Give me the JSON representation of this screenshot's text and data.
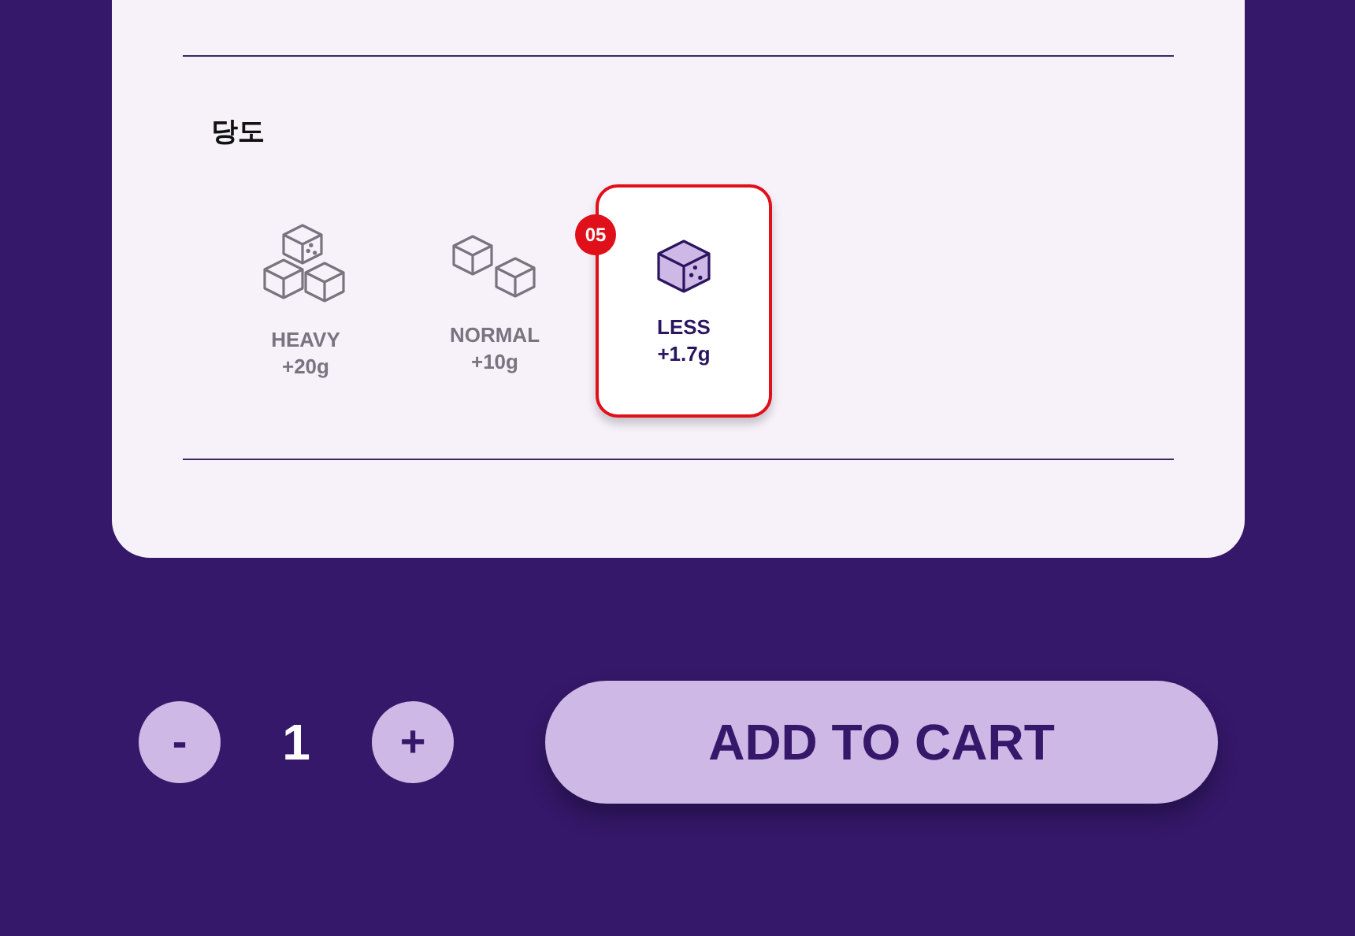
{
  "section": {
    "title": "당도",
    "options": [
      {
        "kind": "three",
        "label": "HEAVY",
        "amount": "+20g",
        "selected": false
      },
      {
        "kind": "two",
        "label": "NORMAL",
        "amount": "+10g",
        "selected": false
      },
      {
        "kind": "one",
        "label": "LESS",
        "amount": "+1.7g",
        "selected": true,
        "badge": "05"
      }
    ]
  },
  "quantity": {
    "minus": "-",
    "value": "1",
    "plus": "+"
  },
  "add_to_cart": "ADD TO CART"
}
